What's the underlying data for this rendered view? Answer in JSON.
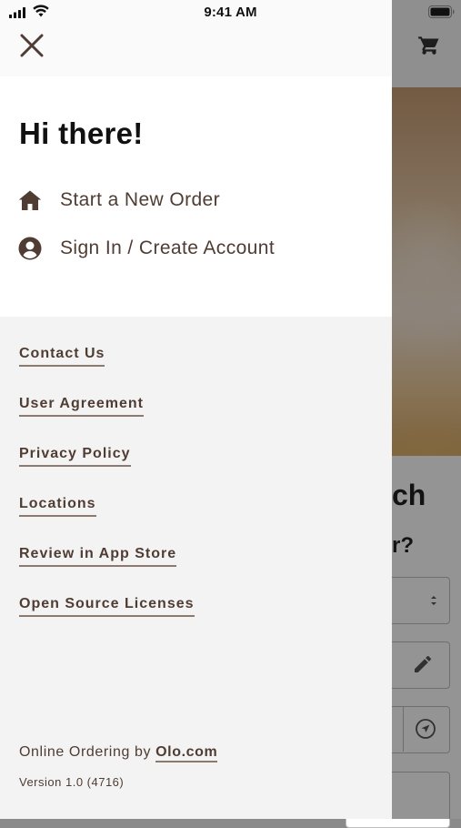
{
  "status_bar": {
    "time": "9:41 AM"
  },
  "drawer": {
    "greeting": "Hi there!",
    "menu": [
      {
        "label": "Start a New Order",
        "icon": "home-icon"
      },
      {
        "label": "Sign In / Create Account",
        "icon": "account-circle-icon"
      }
    ],
    "links": [
      "Contact Us",
      "User Agreement",
      "Privacy Policy",
      "Locations",
      "Review in App Store",
      "Open Source Licenses"
    ],
    "footer": {
      "prefix": "Online Ordering by ",
      "link": "Olo.com",
      "version": "Version 1.0 (4716)"
    }
  },
  "background": {
    "heading_fragment": "ch",
    "subheading_fragment": "r?"
  },
  "colors": {
    "text_brown": "#4f3c33",
    "link_underline": "#8c7a70",
    "drawer_bg": "#f3f3f3",
    "scrim": "rgba(0,0,0,0.42)"
  }
}
